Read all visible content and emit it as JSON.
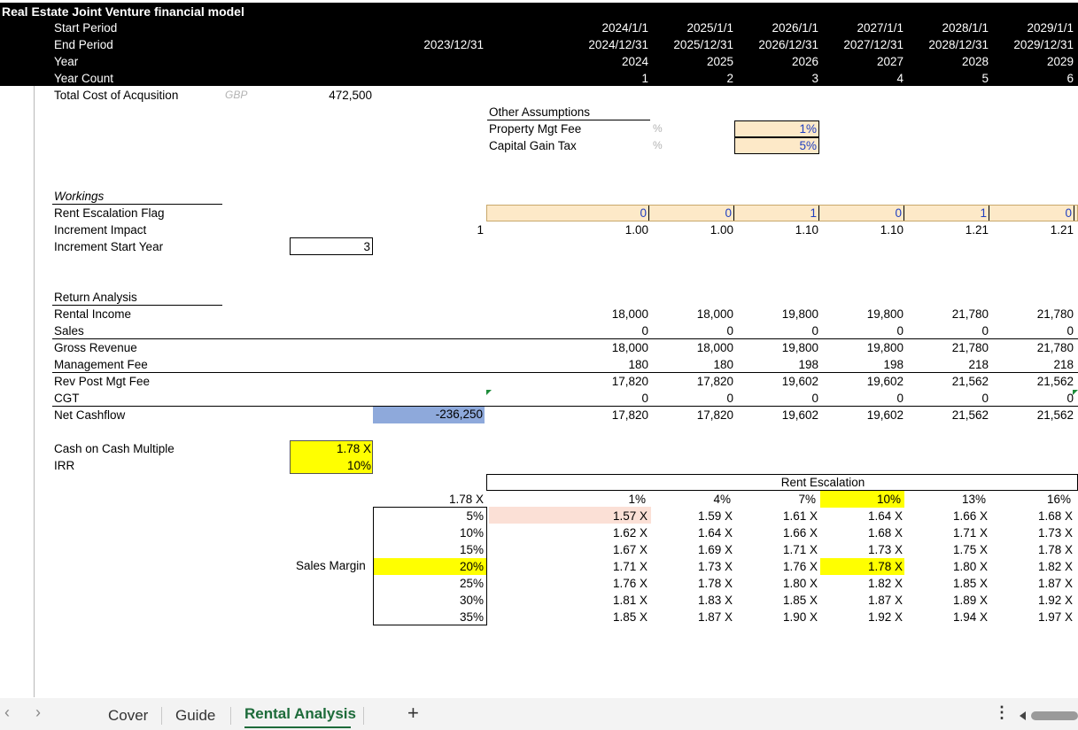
{
  "title": "Real Estate Joint Venture financial model",
  "header_rows": [
    "Start Period",
    "End Period",
    "Year",
    "Year Count"
  ],
  "base_period_end": "2023/12/31",
  "periods": [
    {
      "start": "2024/1/1",
      "end": "2024/12/31",
      "year": "2024",
      "count": "1"
    },
    {
      "start": "2025/1/1",
      "end": "2025/12/31",
      "year": "2025",
      "count": "2"
    },
    {
      "start": "2026/1/1",
      "end": "2026/12/31",
      "year": "2026",
      "count": "3"
    },
    {
      "start": "2027/1/1",
      "end": "2027/12/31",
      "year": "2027",
      "count": "4"
    },
    {
      "start": "2028/1/1",
      "end": "2028/12/31",
      "year": "2028",
      "count": "5"
    },
    {
      "start": "2029/1/1",
      "end": "2029/12/31",
      "year": "2029",
      "count": "6"
    }
  ],
  "acquisition": {
    "label": "Total Cost of Acqusition",
    "unit": "GBP",
    "value": "472,500"
  },
  "other_assumptions": {
    "title": "Other Assumptions",
    "rows": [
      {
        "label": "Property Mgt Fee",
        "unit": "%",
        "value": "1%"
      },
      {
        "label": "Capital Gain Tax",
        "unit": "%",
        "value": "5%"
      }
    ]
  },
  "workings": {
    "title": "Workings",
    "labels": [
      "Rent Escalation Flag",
      "Increment Impact",
      "Increment Start Year"
    ],
    "flags": [
      "0",
      "0",
      "1",
      "0",
      "1",
      "0"
    ],
    "increment_base": "1",
    "increments": [
      "1.00",
      "1.00",
      "1.10",
      "1.10",
      "1.21",
      "1.21"
    ],
    "start_year": "3"
  },
  "return_analysis": {
    "title": "Return Analysis",
    "labels": [
      "Rental Income",
      "Sales",
      "Gross Revenue",
      "Management Fee",
      "Rev Post Mgt Fee",
      "CGT",
      "Net Cashflow"
    ],
    "initial_cashflow": "-236,250",
    "rows": [
      [
        "18,000",
        "18,000",
        "19,800",
        "19,800",
        "21,780",
        "21,780"
      ],
      [
        "0",
        "0",
        "0",
        "0",
        "0",
        "0"
      ],
      [
        "18,000",
        "18,000",
        "19,800",
        "19,800",
        "21,780",
        "21,780"
      ],
      [
        "180",
        "180",
        "198",
        "198",
        "218",
        "218"
      ],
      [
        "17,820",
        "17,820",
        "19,602",
        "19,602",
        "21,562",
        "21,562"
      ],
      [
        "0",
        "0",
        "0",
        "0",
        "0",
        "0"
      ],
      [
        "17,820",
        "17,820",
        "19,602",
        "19,602",
        "21,562",
        "21,562"
      ]
    ]
  },
  "metrics": {
    "labels": [
      "Cash on Cash Multiple",
      "IRR"
    ],
    "values": [
      "1.78 X",
      "10%"
    ]
  },
  "sensitivity": {
    "title": "Rent Escalation",
    "corner": "1.78 X",
    "row_label": "Sales Margin",
    "rows": [
      "5%",
      "10%",
      "15%",
      "20%",
      "25%",
      "30%",
      "35%"
    ],
    "cols": [
      "1%",
      "4%",
      "7%",
      "10%",
      "13%",
      "16%"
    ],
    "cells": [
      [
        "1.57 X",
        "1.59 X",
        "1.61 X",
        "1.64 X",
        "1.66 X",
        "1.68 X"
      ],
      [
        "1.62 X",
        "1.64 X",
        "1.66 X",
        "1.68 X",
        "1.71 X",
        "1.73 X"
      ],
      [
        "1.67 X",
        "1.69 X",
        "1.71 X",
        "1.73 X",
        "1.75 X",
        "1.78 X"
      ],
      [
        "1.71 X",
        "1.73 X",
        "1.76 X",
        "1.78 X",
        "1.80 X",
        "1.82 X"
      ],
      [
        "1.76 X",
        "1.78 X",
        "1.80 X",
        "1.82 X",
        "1.85 X",
        "1.87 X"
      ],
      [
        "1.81 X",
        "1.83 X",
        "1.85 X",
        "1.87 X",
        "1.89 X",
        "1.92 X"
      ],
      [
        "1.85 X",
        "1.87 X",
        "1.90 X",
        "1.92 X",
        "1.94 X",
        "1.97 X"
      ]
    ]
  },
  "tabs": [
    "Cover",
    "Guide",
    "Rental Analysis"
  ],
  "active_tab": "Rental Analysis",
  "icons": {
    "prev": "chevron-left-icon",
    "next": "chevron-right-icon",
    "add": "plus-icon",
    "more": "more-options-icon"
  }
}
